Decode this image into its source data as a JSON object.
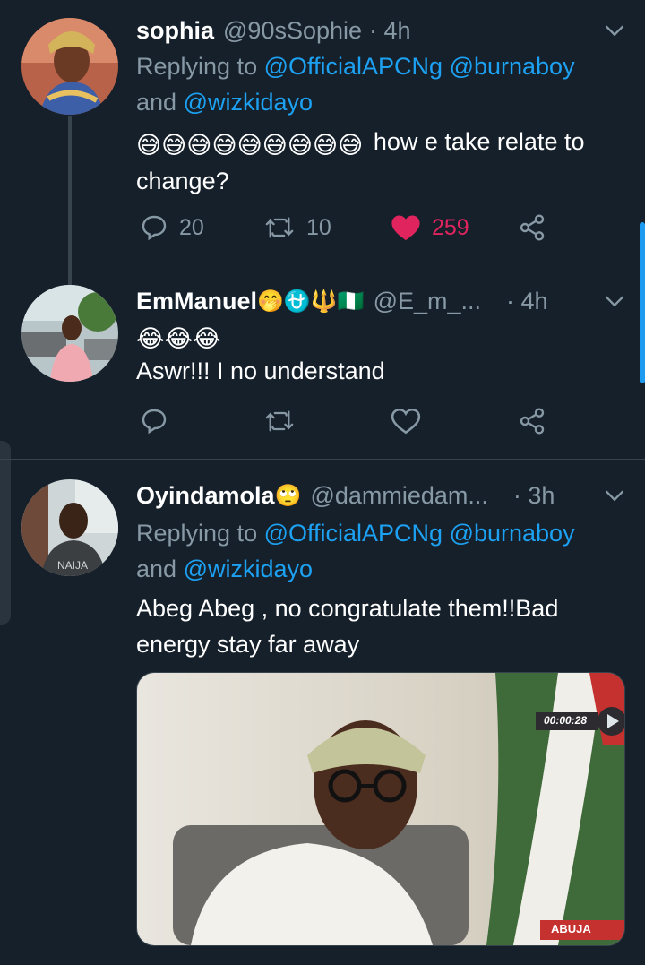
{
  "tweets": [
    {
      "name": "sophia",
      "handle": "@90sSophie",
      "time": "· 4h",
      "replying_prefix": "Replying to ",
      "mention1": "@OfficialAPCNg",
      "mention2": "@burnaboy",
      "and_word": "and ",
      "mention3": "@wizkidayo",
      "emoji": "😅😅😅😅😅😅😅😅😅",
      "text": " how e take relate to change?",
      "reply_count": "20",
      "retweet_count": "10",
      "like_count": "259",
      "liked": true
    },
    {
      "name": "EmManuel",
      "name_emoji": "🤭⛎🔱🇳🇬",
      "handle": "@E_m_...",
      "time": "· 4h",
      "emoji": "😂😂😂",
      "text": "Aswr!!! I no understand",
      "reply_count": "",
      "retweet_count": "",
      "like_count": ""
    },
    {
      "name": "Oyindamola",
      "name_emoji": "🙄",
      "handle": "@dammiedam...",
      "time": "· 3h",
      "replying_prefix": "Replying to ",
      "mention1": "@OfficialAPCNg",
      "mention2": "@burnaboy",
      "and_word": "and ",
      "mention3": "@wizkidayo",
      "text": "Abeg Abeg , no congratulate them!!Bad energy stay far away",
      "media": {
        "timestamp": "00:00:28",
        "location_tag": "ABUJA"
      }
    }
  ],
  "icons": {
    "reply": "reply-icon",
    "retweet": "retweet-icon",
    "like": "heart-icon",
    "share": "share-icon",
    "more": "chevron-down-icon"
  },
  "colors": {
    "background": "#15202b",
    "secondary_text": "#8899a6",
    "link": "#1da1f2",
    "like": "#e0245e",
    "divider": "#38444d"
  }
}
